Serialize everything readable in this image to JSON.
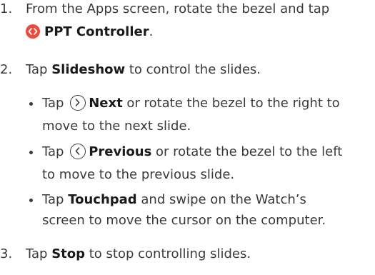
{
  "steps": [
    {
      "number": "1.",
      "line1_text": "From the Apps screen, rotate the bezel and tap",
      "app_name": "PPT Controller",
      "suffix": ".",
      "icon": "ppt-controller-app-icon"
    },
    {
      "number": "2.",
      "pre": "Tap ",
      "keyword": "Slideshow",
      "post": " to control the slides.",
      "bullets": [
        {
          "pre": "Tap ",
          "icon": "chevron-right-circle-icon",
          "keyword": "Next",
          "post": " or rotate the bezel to the right to",
          "line2": "move to the next slide."
        },
        {
          "pre": "Tap ",
          "icon": "chevron-left-circle-icon",
          "keyword": "Previous",
          "post": " or rotate the bezel to the left",
          "line2": "to move to the previous slide."
        },
        {
          "pre": "Tap ",
          "keyword": "Touchpad",
          "post": " and swipe on the Watch’s",
          "line2": "screen to move the cursor on the computer."
        }
      ]
    },
    {
      "number": "3.",
      "pre": "Tap ",
      "keyword": "Stop",
      "post": " to stop controlling slides."
    }
  ],
  "colors": {
    "text": "#3a3a3a",
    "bold_text": "#1a1a1a",
    "app_icon": "#f04a3a"
  }
}
